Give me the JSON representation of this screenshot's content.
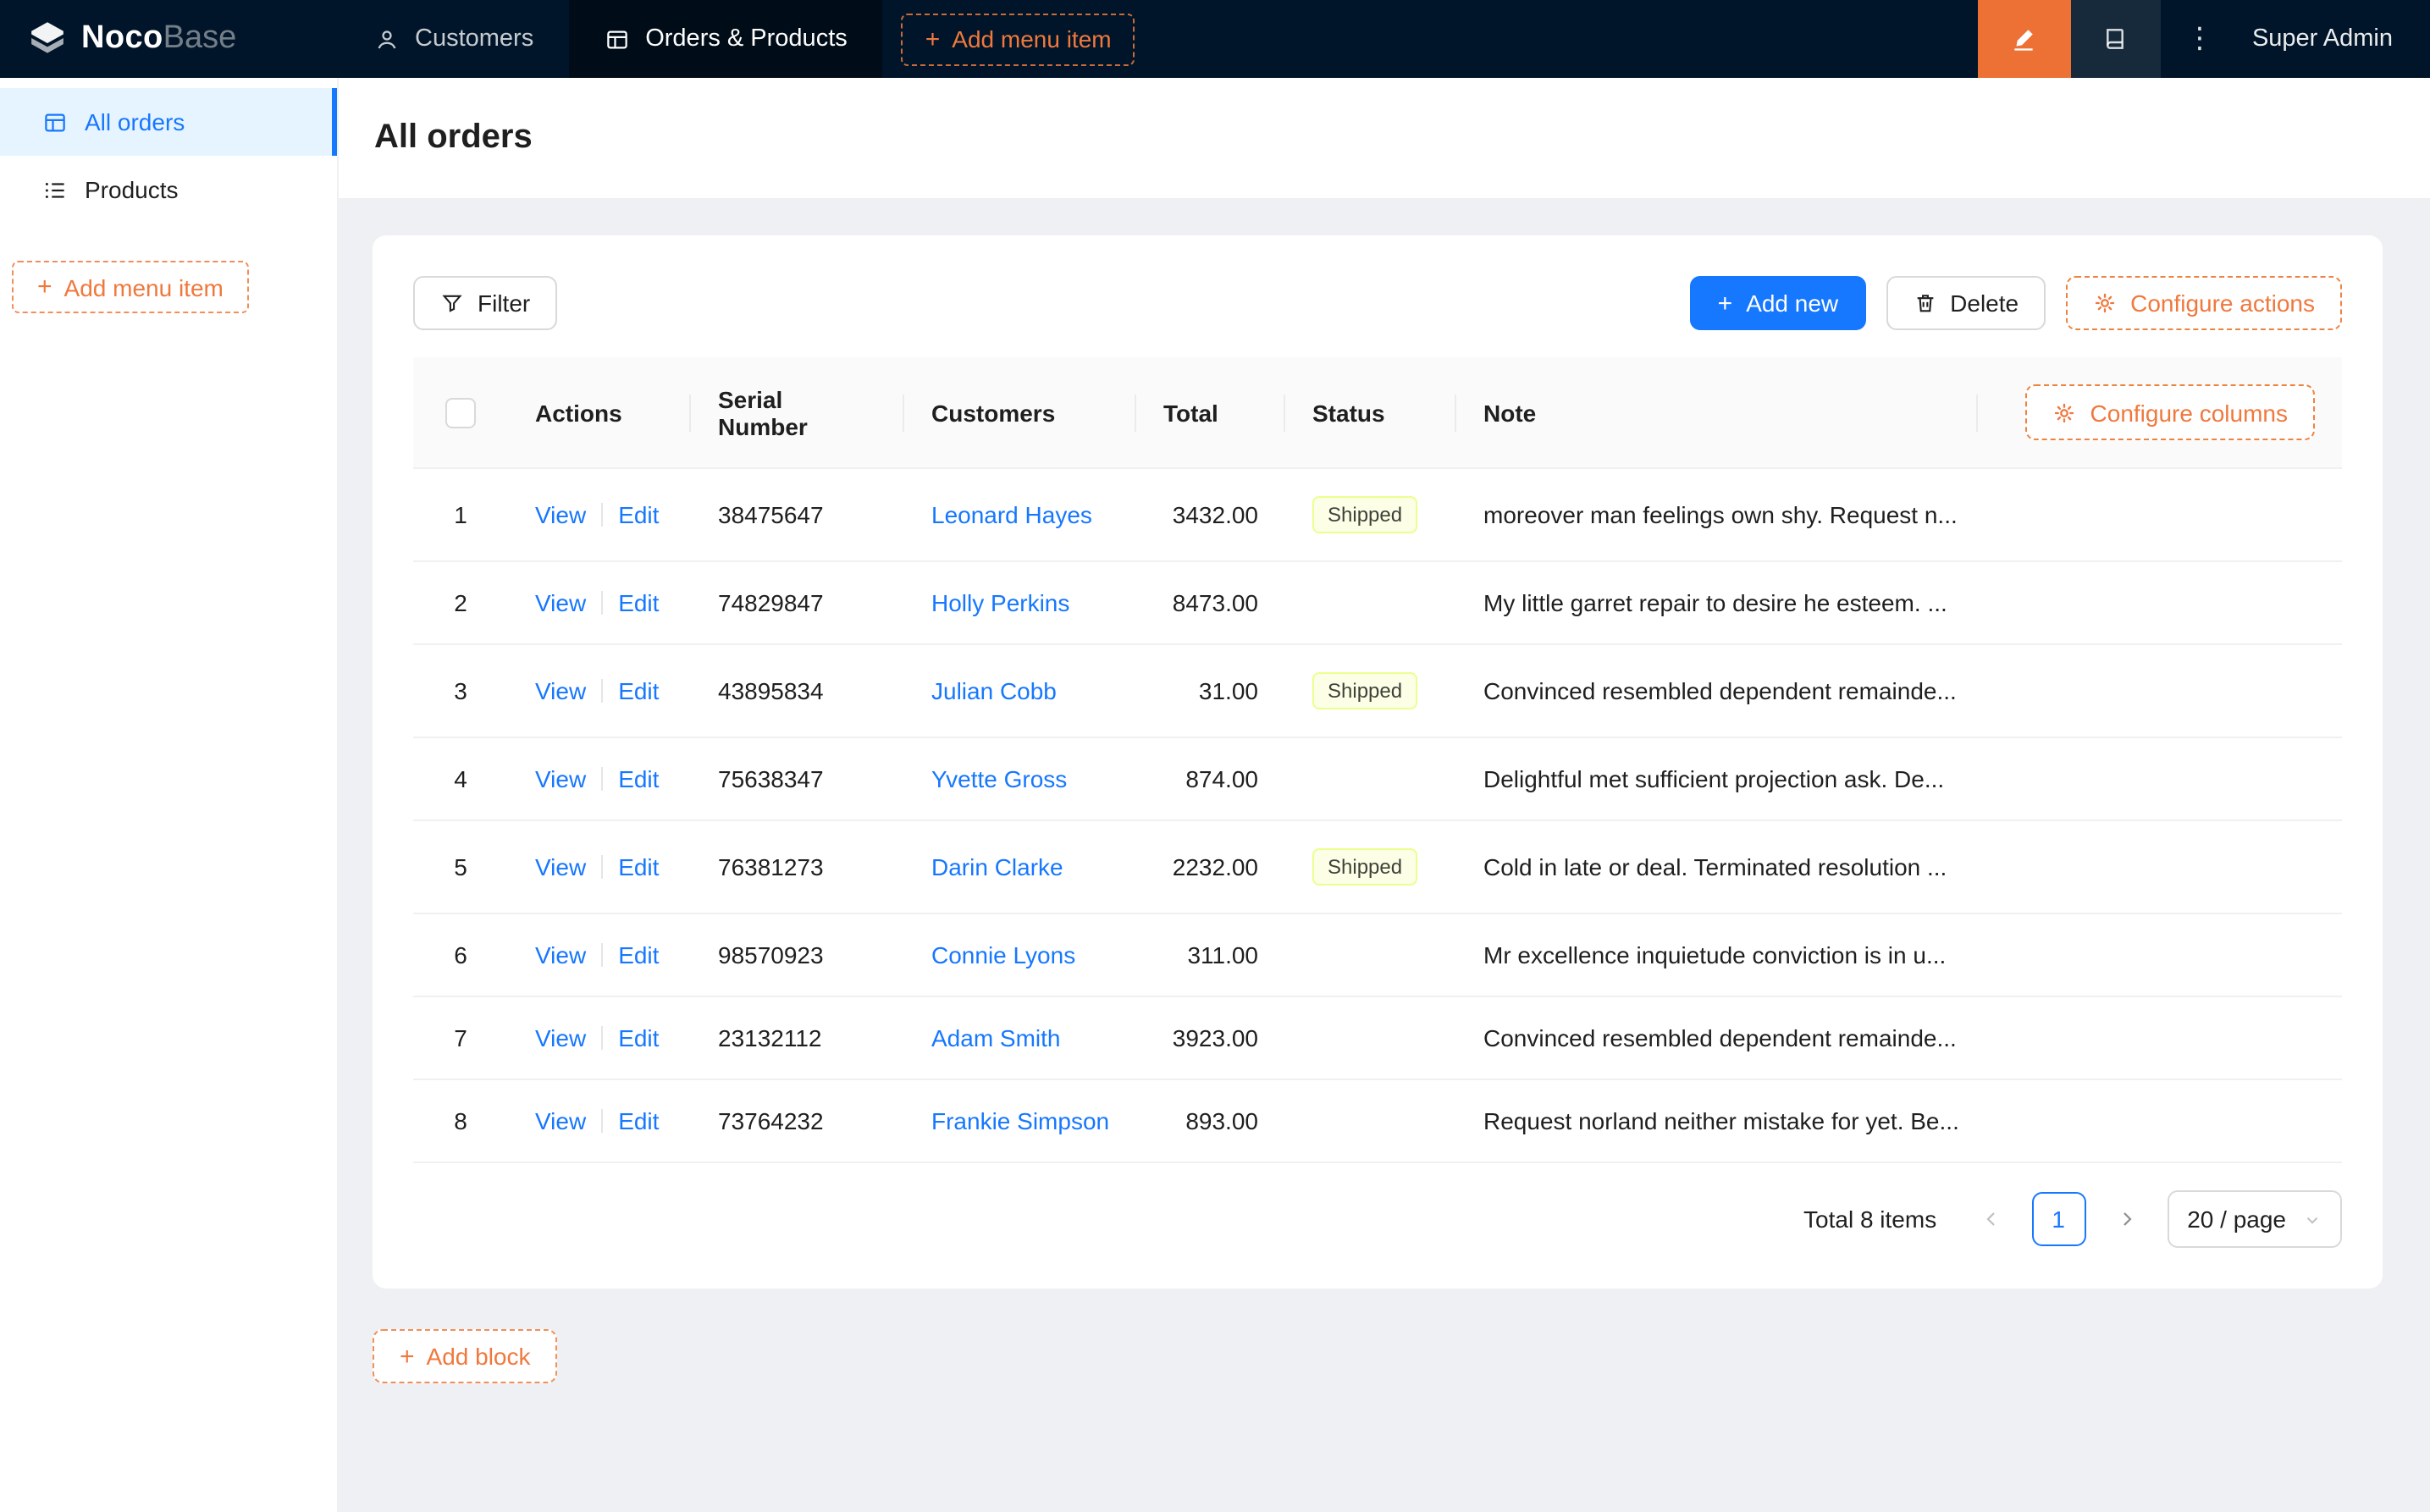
{
  "header": {
    "brand_noco": "Noco",
    "brand_base": "Base",
    "nav": [
      {
        "label": "Customers"
      },
      {
        "label": "Orders & Products"
      }
    ],
    "add_menu_item_label": "Add menu item",
    "user": "Super Admin"
  },
  "sidebar": {
    "items": [
      {
        "label": "All orders",
        "active": true
      },
      {
        "label": "Products",
        "active": false
      }
    ],
    "add_menu_item_label": "Add menu item"
  },
  "page": {
    "title": "All orders",
    "add_block_label": "Add block"
  },
  "toolbar": {
    "filter_label": "Filter",
    "add_new_label": "Add new",
    "delete_label": "Delete",
    "configure_actions_label": "Configure actions"
  },
  "table": {
    "columns": [
      "Actions",
      "Serial Number",
      "Customers",
      "Total",
      "Status",
      "Note"
    ],
    "configure_columns_label": "Configure columns",
    "view_label": "View",
    "edit_label": "Edit",
    "rows": [
      {
        "index": "1",
        "serial": "38475647",
        "customer": "Leonard Hayes",
        "total": "3432.00",
        "status": "Shipped",
        "note": "moreover man feelings own shy. Request n..."
      },
      {
        "index": "2",
        "serial": "74829847",
        "customer": "Holly Perkins",
        "total": "8473.00",
        "status": "",
        "note": "My little garret repair to desire he esteem. ..."
      },
      {
        "index": "3",
        "serial": "43895834",
        "customer": "Julian Cobb",
        "total": "31.00",
        "status": "Shipped",
        "note": "Convinced resembled dependent remainde..."
      },
      {
        "index": "4",
        "serial": "75638347",
        "customer": "Yvette Gross",
        "total": "874.00",
        "status": "",
        "note": "Delightful met sufficient projection ask. De..."
      },
      {
        "index": "5",
        "serial": "76381273",
        "customer": "Darin Clarke",
        "total": "2232.00",
        "status": "Shipped",
        "note": "Cold in late or deal. Terminated resolution ..."
      },
      {
        "index": "6",
        "serial": "98570923",
        "customer": "Connie Lyons",
        "total": "311.00",
        "status": "",
        "note": "Mr excellence inquietude conviction is in u..."
      },
      {
        "index": "7",
        "serial": "23132112",
        "customer": "Adam Smith",
        "total": "3923.00",
        "status": "",
        "note": "Convinced resembled dependent remainde..."
      },
      {
        "index": "8",
        "serial": "73764232",
        "customer": "Frankie Simpson",
        "total": "893.00",
        "status": "",
        "note": "Request norland neither mistake for yet. Be..."
      }
    ]
  },
  "pagination": {
    "total_label": "Total 8 items",
    "page_label": "1",
    "page_size_label": "20 / page"
  },
  "colors": {
    "accent_orange": "#f0783d",
    "primary_blue": "#1677ff",
    "header_bg": "#001529",
    "active_menu_bg": "#e6f4ff",
    "tag_shipped_bg": "#fcffe6",
    "tag_shipped_border": "#eaff8f"
  }
}
